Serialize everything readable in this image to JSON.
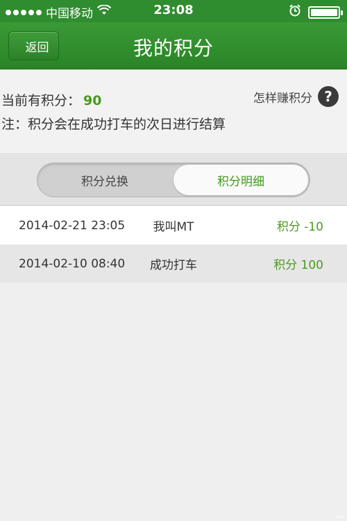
{
  "status_bar": {
    "carrier": "中国移动",
    "time": "23:08",
    "battery_level": 1.0,
    "icons": [
      "signal-dots",
      "wifi-icon",
      "alarm-icon",
      "battery-icon"
    ]
  },
  "nav": {
    "back_label": "返回",
    "title": "我的积分"
  },
  "info": {
    "points_label": "当前有积分：",
    "points_value": "90",
    "note": "注：积分会在成功打车的次日进行结算",
    "how_earn": "怎样赚积分",
    "help_glyph": "?"
  },
  "tabs": [
    {
      "label": "积分兑换",
      "active": false
    },
    {
      "label": "积分明细",
      "active": true
    }
  ],
  "records": [
    {
      "date": "2014-02-21 23:05",
      "desc": "我叫MT",
      "points": "积分 -10"
    },
    {
      "date": "2014-02-10 08:40",
      "desc": "成功打车",
      "points": "积分 100"
    }
  ],
  "watermark": "京牛车服务",
  "colors": {
    "brand_green": "#2f8c2f",
    "accent_green": "#4a9a1e"
  }
}
